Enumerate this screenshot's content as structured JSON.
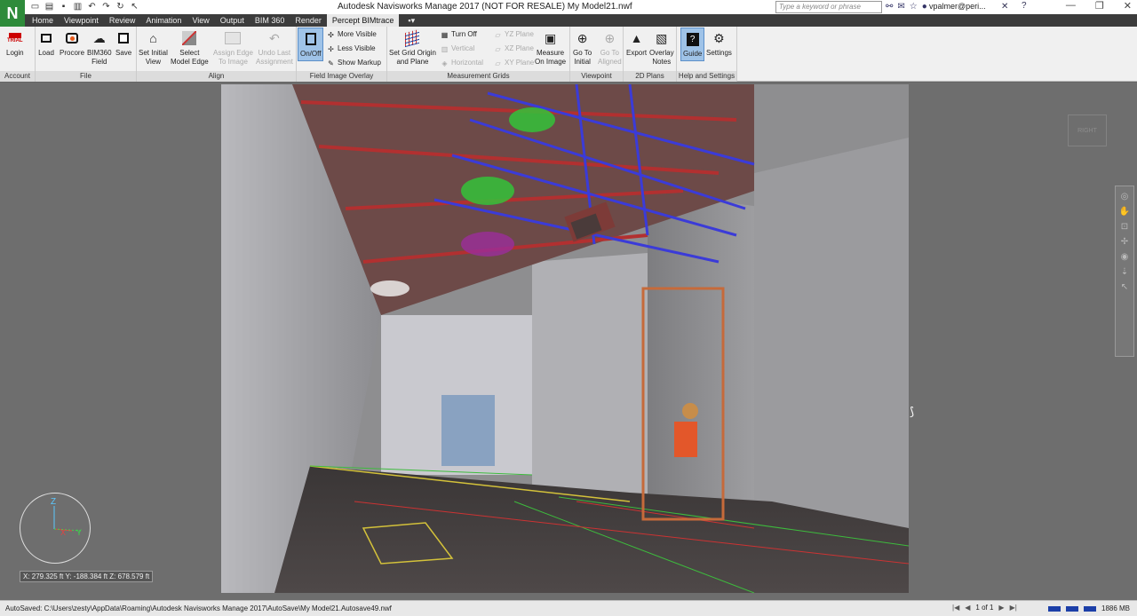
{
  "window": {
    "title": "Autodesk Navisworks Manage 2017 (NOT FOR RESALE)    My Model21.nwf",
    "search_placeholder": "Type a keyword or phrase",
    "user": "vpalmer@peri...",
    "logo": "N"
  },
  "tabs": [
    {
      "label": "Home"
    },
    {
      "label": "Viewpoint"
    },
    {
      "label": "Review"
    },
    {
      "label": "Animation"
    },
    {
      "label": "View"
    },
    {
      "label": "Output"
    },
    {
      "label": "BIM 360"
    },
    {
      "label": "Render"
    },
    {
      "label": "Percept BIMtrace"
    }
  ],
  "ribbon": {
    "account": {
      "label": "Account",
      "login": "Login",
      "trial": "TRIAL"
    },
    "file": {
      "label": "File",
      "load": "Load",
      "procore": "Procore",
      "bim360_a": "BIM360",
      "bim360_b": "Field",
      "save": "Save"
    },
    "align": {
      "label": "Align",
      "set_initial_a": "Set Initial",
      "set_initial_b": "View",
      "select_edge_a": "Select",
      "select_edge_b": "Model Edge",
      "assign_edge_a": "Assign Edge",
      "assign_edge_b": "To Image",
      "undo_a": "Undo Last",
      "undo_b": "Assignment"
    },
    "overlay": {
      "label": "Field Image Overlay",
      "onoff": "On/Off",
      "more": "More Visible",
      "less": "Less Visible",
      "markup": "Show Markup"
    },
    "grids": {
      "label": "Measurement Grids",
      "set_grid_a": "Set Grid Origin",
      "set_grid_b": "and Plane",
      "turn_off": "Turn Off",
      "vertical": "Vertical",
      "horizontal": "Horizontal",
      "yz": "YZ Plane",
      "xz": "XZ Plane",
      "xy": "XY Plane",
      "measure_a": "Measure",
      "measure_b": "On Image"
    },
    "viewpoint": {
      "label": "Viewpoint",
      "goto_initial_a": "Go To",
      "goto_initial_b": "Initial",
      "goto_aligned_a": "Go To",
      "goto_aligned_b": "Aligned"
    },
    "plans": {
      "label": "2D Plans",
      "export": "Export",
      "overlay_a": "Overlay",
      "overlay_b": "Notes"
    },
    "help": {
      "label": "Help and Settings",
      "guide": "Guide",
      "settings": "Settings"
    }
  },
  "viewport": {
    "coords": "X: 279.325 ft  Y: -188.384 ft  Z: 678.579 ft",
    "viewcube_label": "RIGHT",
    "axis_z": "Z",
    "axis_x": "X",
    "axis_y": "Y"
  },
  "status": {
    "text": "AutoSaved: C:\\Users\\zesty\\AppData\\Roaming\\Autodesk Navisworks Manage 2017\\AutoSave\\My Model21.Autosave49.nwf",
    "page": "1 of 1",
    "memory": "1886 MB"
  }
}
